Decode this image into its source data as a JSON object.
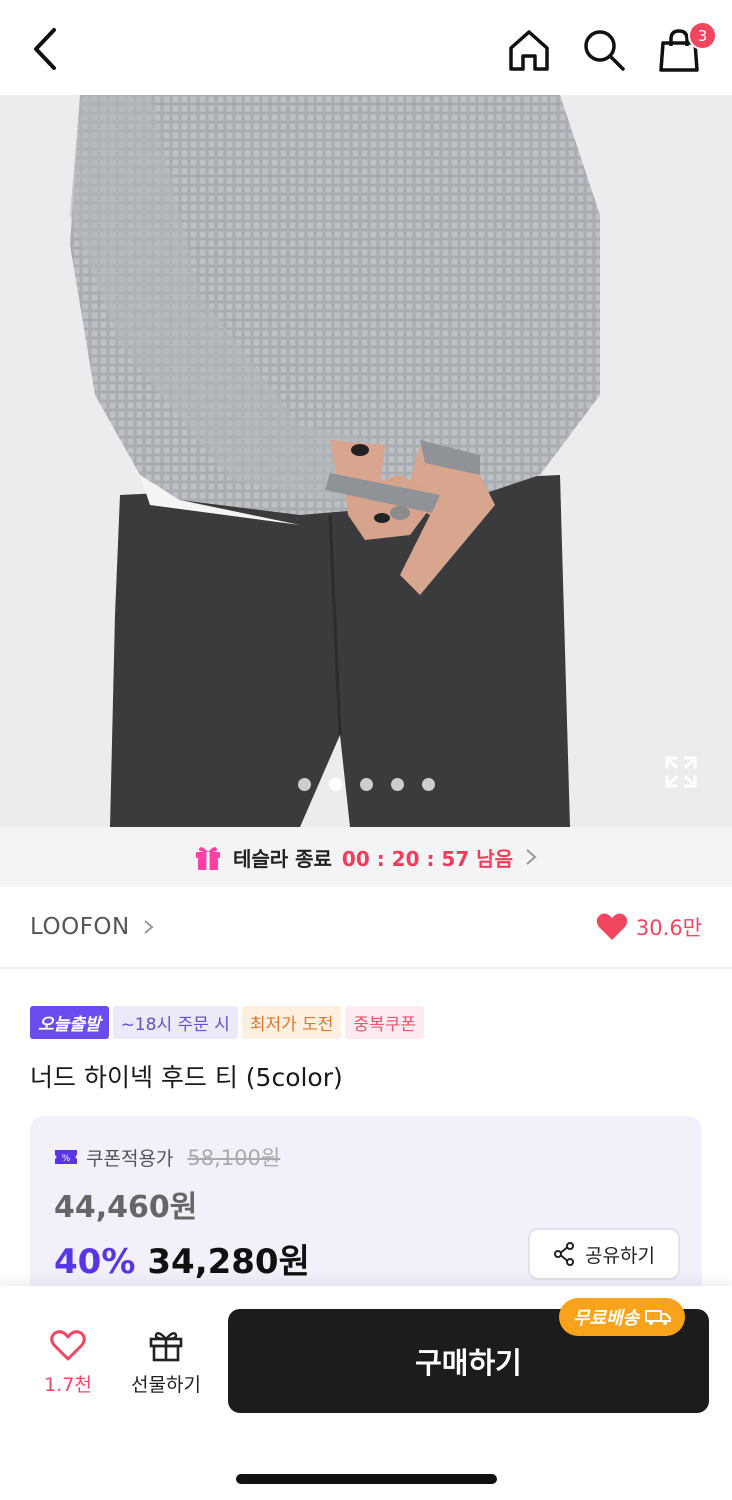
{
  "header": {
    "cart_count": "3"
  },
  "gallery": {
    "slide_count": 5,
    "active_slide": 2
  },
  "timer": {
    "label": "테슬라 종료",
    "time": "00 : 20 : 57 남음"
  },
  "brand": {
    "name": "LOOFON",
    "like_count": "30.6만"
  },
  "tags": [
    {
      "label": "오늘출발"
    },
    {
      "label": "~18시 주문 시"
    },
    {
      "label": "최저가 도전"
    },
    {
      "label": "중복쿠폰"
    }
  ],
  "product": {
    "title": "너드 하이넥 후드 티 (5color)"
  },
  "price": {
    "coupon_label": "쿠폰적용가",
    "original": "58,100원",
    "sale": "44,460원",
    "discount": "40%",
    "final": "34,280원",
    "share_label": "공유하기"
  },
  "bottom": {
    "like_count": "1.7천",
    "gift_label": "선물하기",
    "buy_label": "구매하기",
    "shipping_badge": "무료배송"
  },
  "colors": {
    "accent_purple": "#5a35e8",
    "like_red": "#f2455f",
    "ship_orange": "#f9a21b",
    "buy_black": "#1c1c1e"
  }
}
